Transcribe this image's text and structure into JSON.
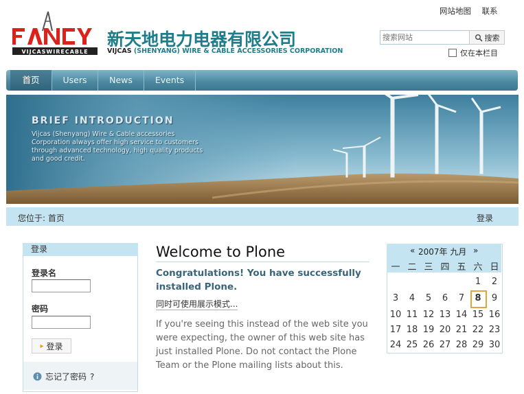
{
  "top_links": [
    "网站地图",
    "联系"
  ],
  "logo": {
    "brand": "FANCY",
    "brand_sub": "VIJCASWIRECABLE",
    "company_cn": "新天地电力电器有限公司",
    "company_en_bold": "VIJCAS",
    "company_en_rest": " (SHENYANG) WIRE & CABLE ACCESSORIES CORPORATION"
  },
  "search": {
    "placeholder": "搜索网站",
    "button": "搜索",
    "only_section": "仅在本栏目"
  },
  "nav": {
    "tabs": [
      "首页",
      "Users",
      "News",
      "Events"
    ],
    "active": "首页"
  },
  "banner": {
    "title": "BRIEF INTRODUCTION",
    "body": "Vijcas (Shenyang) Wire & Cable accessories Corporation always offer high service to customers through advanced technology, high quality products and good credit."
  },
  "breadcrumb": {
    "prefix": "您位于:",
    "item": "首页",
    "login": "登录"
  },
  "login_portlet": {
    "title": "登录",
    "username_label": "登录名",
    "password_label": "密码",
    "button": "登录",
    "forgot": "忘记了密码",
    "forgot_mark": "?"
  },
  "main": {
    "title": "Welcome to Plone",
    "description": "Congratulations! You have successfully installed Plone.",
    "demo_link": "同时可使用展示模式...",
    "body": "If you're seeing this instead of the web site you were expecting, the owner of this web site has just installed Plone. Do not contact the Plone Team or the Plone mailing lists about this."
  },
  "calendar": {
    "prev": "«",
    "next": "»",
    "month_label": "2007年 九月",
    "weekdays": [
      "一",
      "二",
      "三",
      "四",
      "五",
      "六",
      "日"
    ],
    "weeks": [
      [
        "",
        "",
        "",
        "",
        "",
        "1",
        "2"
      ],
      [
        "3",
        "4",
        "5",
        "6",
        "7",
        "8",
        "9"
      ],
      [
        "10",
        "11",
        "12",
        "13",
        "14",
        "15",
        "16"
      ],
      [
        "17",
        "18",
        "19",
        "20",
        "21",
        "22",
        "23"
      ],
      [
        "24",
        "25",
        "26",
        "27",
        "28",
        "29",
        "30"
      ]
    ],
    "today": "8",
    "colors": {
      "today_border": "#e4a43c",
      "header_bg": "#c4e4f1"
    }
  },
  "colors": {
    "brand_red": "#d9231c",
    "brand_teal": "#1e7d8a",
    "nav_blue": "#4d8aa2",
    "light_blue": "#c4e4f1"
  }
}
